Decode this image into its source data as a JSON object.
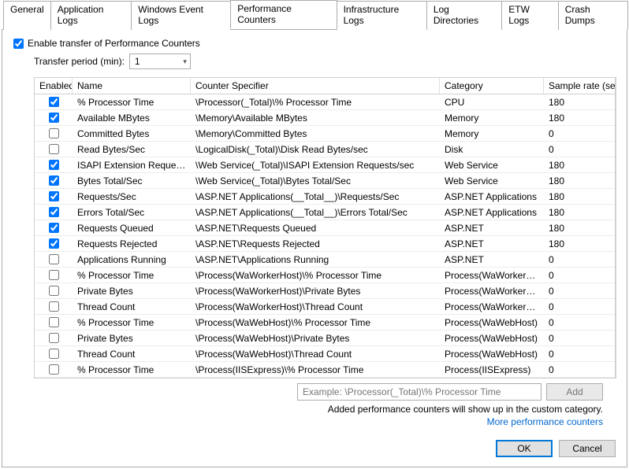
{
  "tabs": [
    "General",
    "Application Logs",
    "Windows Event Logs",
    "Performance Counters",
    "Infrastructure Logs",
    "Log Directories",
    "ETW Logs",
    "Crash Dumps"
  ],
  "activeTabIndex": 3,
  "enable": {
    "checked": true,
    "label": "Enable transfer of Performance Counters"
  },
  "transfer": {
    "label": "Transfer period (min):",
    "value": "1"
  },
  "columns": [
    "Enabled",
    "Name",
    "Counter Specifier",
    "Category",
    "Sample rate (sec)"
  ],
  "rows": [
    {
      "enabled": true,
      "name": "% Processor Time",
      "spec": "\\Processor(_Total)\\% Processor Time",
      "cat": "CPU",
      "rate": "180"
    },
    {
      "enabled": true,
      "name": "Available MBytes",
      "spec": "\\Memory\\Available MBytes",
      "cat": "Memory",
      "rate": "180"
    },
    {
      "enabled": false,
      "name": "Committed Bytes",
      "spec": "\\Memory\\Committed Bytes",
      "cat": "Memory",
      "rate": "0"
    },
    {
      "enabled": false,
      "name": "Read Bytes/Sec",
      "spec": "\\LogicalDisk(_Total)\\Disk Read Bytes/sec",
      "cat": "Disk",
      "rate": "0"
    },
    {
      "enabled": true,
      "name": "ISAPI Extension Requests/...",
      "spec": "\\Web Service(_Total)\\ISAPI Extension Requests/sec",
      "cat": "Web Service",
      "rate": "180"
    },
    {
      "enabled": true,
      "name": "Bytes Total/Sec",
      "spec": "\\Web Service(_Total)\\Bytes Total/Sec",
      "cat": "Web Service",
      "rate": "180"
    },
    {
      "enabled": true,
      "name": "Requests/Sec",
      "spec": "\\ASP.NET Applications(__Total__)\\Requests/Sec",
      "cat": "ASP.NET Applications",
      "rate": "180"
    },
    {
      "enabled": true,
      "name": "Errors Total/Sec",
      "spec": "\\ASP.NET Applications(__Total__)\\Errors Total/Sec",
      "cat": "ASP.NET Applications",
      "rate": "180"
    },
    {
      "enabled": true,
      "name": "Requests Queued",
      "spec": "\\ASP.NET\\Requests Queued",
      "cat": "ASP.NET",
      "rate": "180"
    },
    {
      "enabled": true,
      "name": "Requests Rejected",
      "spec": "\\ASP.NET\\Requests Rejected",
      "cat": "ASP.NET",
      "rate": "180"
    },
    {
      "enabled": false,
      "name": "Applications Running",
      "spec": "\\ASP.NET\\Applications Running",
      "cat": "ASP.NET",
      "rate": "0"
    },
    {
      "enabled": false,
      "name": "% Processor Time",
      "spec": "\\Process(WaWorkerHost)\\% Processor Time",
      "cat": "Process(WaWorkerHost)",
      "rate": "0"
    },
    {
      "enabled": false,
      "name": "Private Bytes",
      "spec": "\\Process(WaWorkerHost)\\Private Bytes",
      "cat": "Process(WaWorkerHost)",
      "rate": "0"
    },
    {
      "enabled": false,
      "name": "Thread Count",
      "spec": "\\Process(WaWorkerHost)\\Thread Count",
      "cat": "Process(WaWorkerHost)",
      "rate": "0"
    },
    {
      "enabled": false,
      "name": "% Processor Time",
      "spec": "\\Process(WaWebHost)\\% Processor Time",
      "cat": "Process(WaWebHost)",
      "rate": "0"
    },
    {
      "enabled": false,
      "name": "Private Bytes",
      "spec": "\\Process(WaWebHost)\\Private Bytes",
      "cat": "Process(WaWebHost)",
      "rate": "0"
    },
    {
      "enabled": false,
      "name": "Thread Count",
      "spec": "\\Process(WaWebHost)\\Thread Count",
      "cat": "Process(WaWebHost)",
      "rate": "0"
    },
    {
      "enabled": false,
      "name": "% Processor Time",
      "spec": "\\Process(IISExpress)\\% Processor Time",
      "cat": "Process(IISExpress)",
      "rate": "0"
    }
  ],
  "addInput": {
    "placeholder": "Example: \\Processor(_Total)\\% Processor Time"
  },
  "addButton": "Add",
  "hint": "Added performance counters will show up in the custom category.",
  "link": "More performance counters",
  "ok": "OK",
  "cancel": "Cancel"
}
